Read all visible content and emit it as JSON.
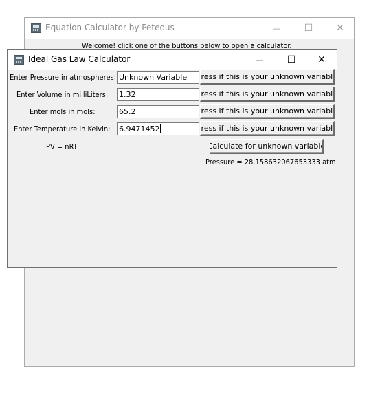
{
  "main_window": {
    "title": "Equation Calculator by Peteous",
    "welcome_text": "Welcome! click one of the buttons below to open a calculator.",
    "controls": {
      "minimize": "—",
      "maximize": "☐",
      "close": "✕"
    }
  },
  "calc_window": {
    "title": "Ideal Gas Law Calculator",
    "controls": {
      "minimize": "—",
      "maximize": "☐",
      "close": "✕"
    },
    "rows": [
      {
        "label": "Enter Pressure in atmospheres:",
        "value": "Unknown Variable",
        "button": "Press if this is your unknown variable"
      },
      {
        "label": "Enter Volume in milliLiters:",
        "value": "1.32",
        "button": "Press if this is your unknown variable"
      },
      {
        "label": "Enter mols in mols:",
        "value": "65.2",
        "button": "Press if this is your unknown variable"
      },
      {
        "label": "Enter Temperature in Kelvin:",
        "value": "6.9471452",
        "button": "Press if this is your unknown variable"
      }
    ],
    "formula": "PV = nRT",
    "calculate_button": "Calculate for unknown variable",
    "result": "Pressure = 28.158632067653333 atm"
  }
}
